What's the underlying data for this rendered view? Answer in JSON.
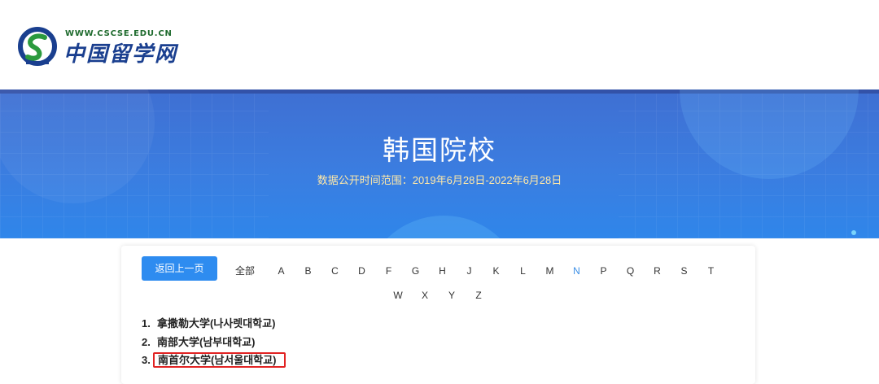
{
  "header": {
    "logo_url": "WWW.CSCSE.EDU.CN",
    "logo_name": "中国留学网",
    "logo_icon": "cscse-logo-icon"
  },
  "banner": {
    "title": "韩国院校",
    "subtitle": "数据公开时间范围：2019年6月28日-2022年6月28日"
  },
  "nav": {
    "back_label": "返回上一页",
    "all_label": "全部",
    "letters_row1": [
      "A",
      "B",
      "C",
      "D",
      "F",
      "G",
      "H",
      "J",
      "K",
      "L",
      "M",
      "N",
      "P",
      "Q",
      "R",
      "S",
      "T"
    ],
    "letters_row2": [
      "W",
      "X",
      "Y",
      "Z"
    ],
    "active_letter": "N"
  },
  "universities": [
    {
      "num": "1.",
      "name": "拿撒勒大学(나사렛대학교)"
    },
    {
      "num": "2.",
      "name": "南部大学(남부대학교)"
    },
    {
      "num": "3.",
      "name": "南首尔大学(남서울대학교)",
      "highlighted": true
    }
  ],
  "colors": {
    "accent": "#2e8cf0",
    "banner_blue": "#3b7de0",
    "highlight_border": "#e12323",
    "subtitle": "#ffe9a8"
  }
}
